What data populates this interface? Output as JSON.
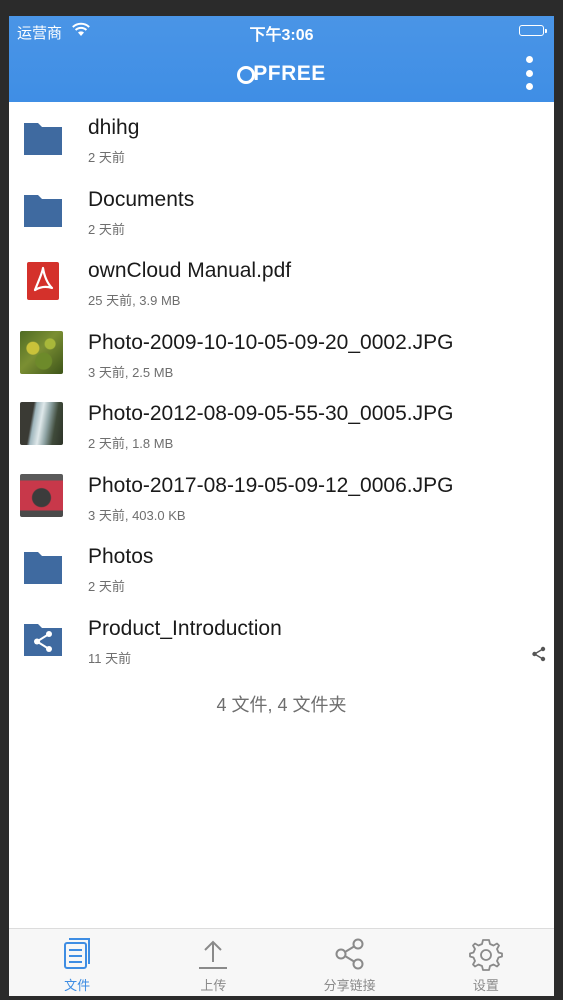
{
  "status_bar": {
    "carrier": "运营商",
    "time": "下午3:06"
  },
  "header": {
    "brand": "PFREE",
    "brand_prefix": "O"
  },
  "files": [
    {
      "name": "dhihg",
      "meta": "2 天前",
      "kind": "folder"
    },
    {
      "name": "Documents",
      "meta": "2 天前",
      "kind": "folder"
    },
    {
      "name": "ownCloud Manual.pdf",
      "meta": "25 天前, 3.9 MB",
      "kind": "pdf"
    },
    {
      "name": "Photo-2009-10-10-05-09-20_0002.JPG",
      "meta": "3 天前, 2.5 MB",
      "kind": "photo"
    },
    {
      "name": "Photo-2012-08-09-05-55-30_0005.JPG",
      "meta": "2 天前, 1.8 MB",
      "kind": "photo"
    },
    {
      "name": "Photo-2017-08-19-05-09-12_0006.JPG",
      "meta": "3 天前, 403.0 KB",
      "kind": "photo"
    },
    {
      "name": "Photos",
      "meta": "2 天前",
      "kind": "folder"
    },
    {
      "name": "Product_Introduction",
      "meta": "11 天前",
      "kind": "shared-folder"
    }
  ],
  "summary": "4 文件, 4 文件夹",
  "tabs": [
    {
      "label": "文件",
      "icon": "files-icon",
      "active": true
    },
    {
      "label": "上传",
      "icon": "upload-icon",
      "active": false
    },
    {
      "label": "分享链接",
      "icon": "share-link-icon",
      "active": false
    },
    {
      "label": "设置",
      "icon": "settings-icon",
      "active": false
    }
  ],
  "colors": {
    "accent": "#3e8de3",
    "header": "#4391e5",
    "folder": "#3f6aa0",
    "pdf": "#d4312b"
  }
}
